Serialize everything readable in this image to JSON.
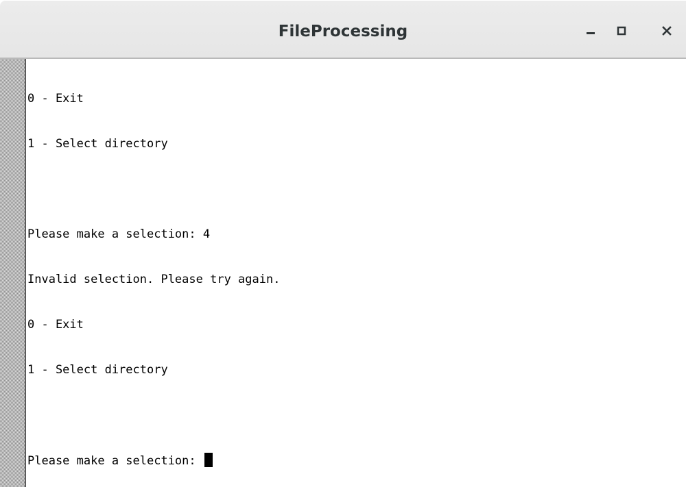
{
  "window": {
    "title": "FileProcessing",
    "controls": {
      "minimize_icon": "minimize-icon",
      "maximize_icon": "maximize-icon",
      "close_icon": "close-icon"
    }
  },
  "terminal": {
    "lines": [
      "0 - Exit",
      "1 - Select directory",
      "",
      "Please make a selection: 4",
      "Invalid selection. Please try again.",
      "0 - Exit",
      "1 - Select directory",
      ""
    ],
    "prompt": "Please make a selection: ",
    "input_value": ""
  },
  "colors": {
    "titlebar_bg": "#e8e8e8",
    "title_text": "#2e3436",
    "terminal_bg": "#ffffff",
    "terminal_text": "#000000"
  }
}
